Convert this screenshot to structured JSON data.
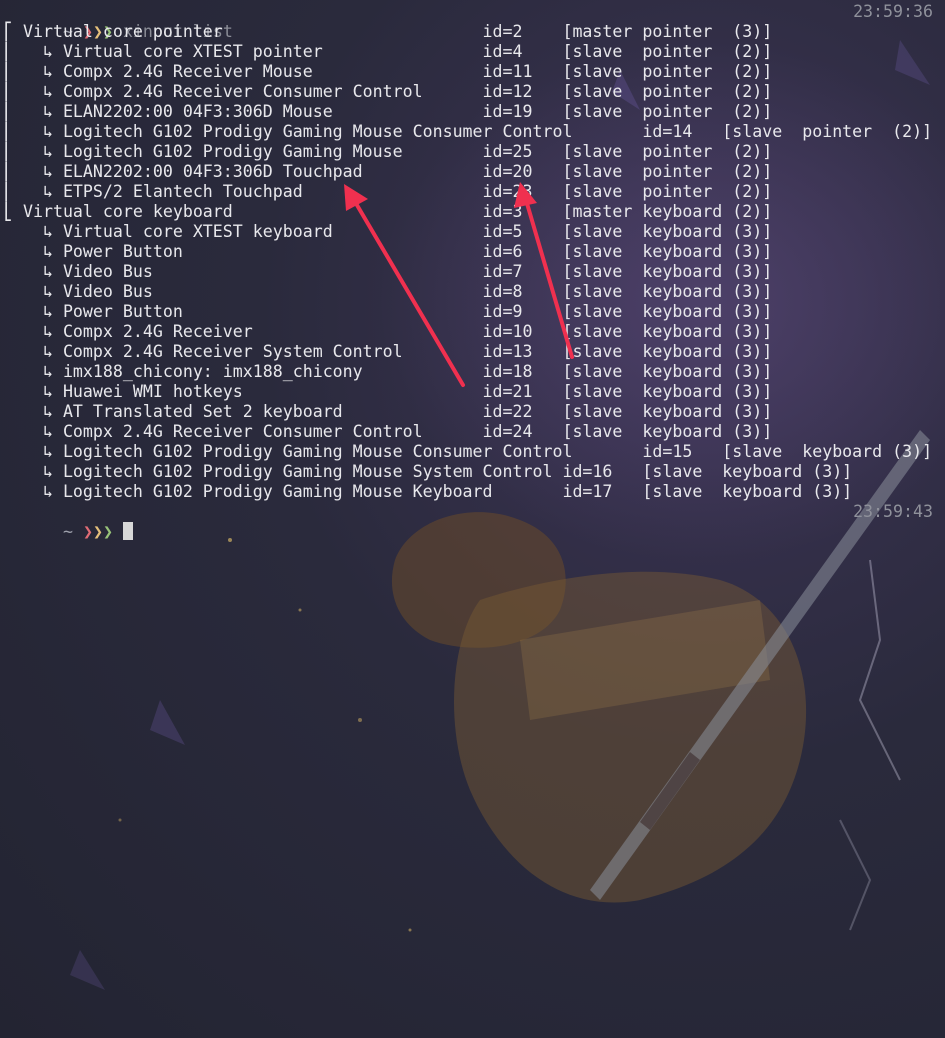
{
  "prompt": {
    "tilde": "~",
    "arrow_glyphs": [
      "❯",
      "❯",
      "❯"
    ],
    "colors": {
      "arrow1": "#e06c75",
      "arrow2": "#e5c07b",
      "arrow3": "#98c379",
      "annotation_arrow": "#f0304f"
    }
  },
  "session": {
    "command": "xinput list",
    "command_time": "23:59:36",
    "next_prompt_time": "23:59:43"
  },
  "output_lines": [
    "⎡ Virtual core pointer                          id=2    [master pointer  (3)]",
    "⎜   ↳ Virtual core XTEST pointer                id=4    [slave  pointer  (2)]",
    "⎜   ↳ Compx 2.4G Receiver Mouse                 id=11   [slave  pointer  (2)]",
    "⎜   ↳ Compx 2.4G Receiver Consumer Control      id=12   [slave  pointer  (2)]",
    "⎜   ↳ ELAN2202:00 04F3:306D Mouse               id=19   [slave  pointer  (2)]",
    "⎜   ↳ Logitech G102 Prodigy Gaming Mouse Consumer Control       id=14   [slave  pointer  (2)]",
    "⎜   ↳ Logitech G102 Prodigy Gaming Mouse        id=25   [slave  pointer  (2)]",
    "⎜   ↳ ELAN2202:00 04F3:306D Touchpad            id=20   [slave  pointer  (2)]",
    "⎜   ↳ ETPS/2 Elantech Touchpad                  id=23   [slave  pointer  (2)]",
    "⎣ Virtual core keyboard                         id=3    [master keyboard (2)]",
    "    ↳ Virtual core XTEST keyboard               id=5    [slave  keyboard (3)]",
    "    ↳ Power Button                              id=6    [slave  keyboard (3)]",
    "    ↳ Video Bus                                 id=7    [slave  keyboard (3)]",
    "    ↳ Video Bus                                 id=8    [slave  keyboard (3)]",
    "    ↳ Power Button                              id=9    [slave  keyboard (3)]",
    "    ↳ Compx 2.4G Receiver                       id=10   [slave  keyboard (3)]",
    "    ↳ Compx 2.4G Receiver System Control        id=13   [slave  keyboard (3)]",
    "    ↳ imx188_chicony: imx188_chicony            id=18   [slave  keyboard (3)]",
    "    ↳ Huawei WMI hotkeys                        id=21   [slave  keyboard (3)]",
    "    ↳ AT Translated Set 2 keyboard              id=22   [slave  keyboard (3)]",
    "    ↳ Compx 2.4G Receiver Consumer Control      id=24   [slave  keyboard (3)]",
    "    ↳ Logitech G102 Prodigy Gaming Mouse Consumer Control       id=15   [slave  keyboard (3)]",
    "    ↳ Logitech G102 Prodigy Gaming Mouse System Control id=16   [slave  keyboard (3)]",
    "    ↳ Logitech G102 Prodigy Gaming Mouse Keyboard       id=17   [slave  keyboard (3)]"
  ]
}
